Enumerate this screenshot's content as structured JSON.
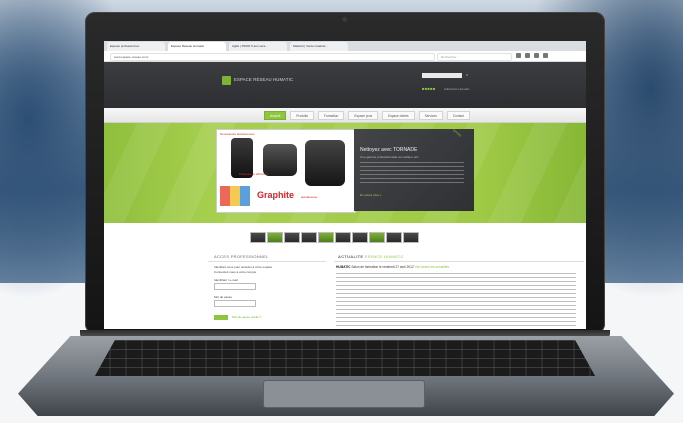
{
  "browser": {
    "tabs": [
      "Espace professionnel...",
      "Espace Réseau Humatic",
      "Agilis | PROD 5 ans sera...",
      "Matériel | Vente matériel..."
    ],
    "active_tab": 1,
    "url": "www.espace-reseau.com/",
    "search_placeholder": "Rechercher"
  },
  "site": {
    "brand": "ESPACE RÉSEAU HUMATIC",
    "login_close": "×",
    "stars": "■■■■■",
    "members_label": "Adhérents Humatic"
  },
  "nav": {
    "items": [
      "Accueil",
      "Produits",
      "Formation",
      "Espace pros",
      "Espace clients",
      "Services",
      "Contact"
    ],
    "active_index": 0
  },
  "hero": {
    "promo_tag": "Nouveautés autolaveuses",
    "caption": "Pratiques et efficaces",
    "product_name": "Graphite",
    "product_sub": "autolaveuse",
    "ribbon": "OFFRE",
    "panel_title": "Nettoyez avec TORNADE",
    "panel_subtitle": "Une gamme professionnelle au meilleur prix",
    "panel_link": "En savoir plus »"
  },
  "sections": {
    "left_title": "ACCES PROFESSIONNEL",
    "right_title_prefix": "ACTUALITE",
    "right_title_accent": "ESPACE HUMATIC"
  },
  "login_box": {
    "line1": "Identifiez-vous pour accéder à votre espace",
    "line2": "Connectez-vous à votre compte",
    "email_label": "Identifiant / e-mail",
    "password_label": "Mot de passe",
    "forgot_link": "Mot de passe oublié ?"
  },
  "news": {
    "headline_bold": "HUMATIC",
    "headline_text": "Salon de formation le vendredi 27 avril 2012",
    "headline_accent": "Voir toutes les actualités"
  },
  "colors": {
    "accent": "#8ec63f",
    "header_dark": "#2c2e31",
    "brand_red": "#d4232b"
  }
}
